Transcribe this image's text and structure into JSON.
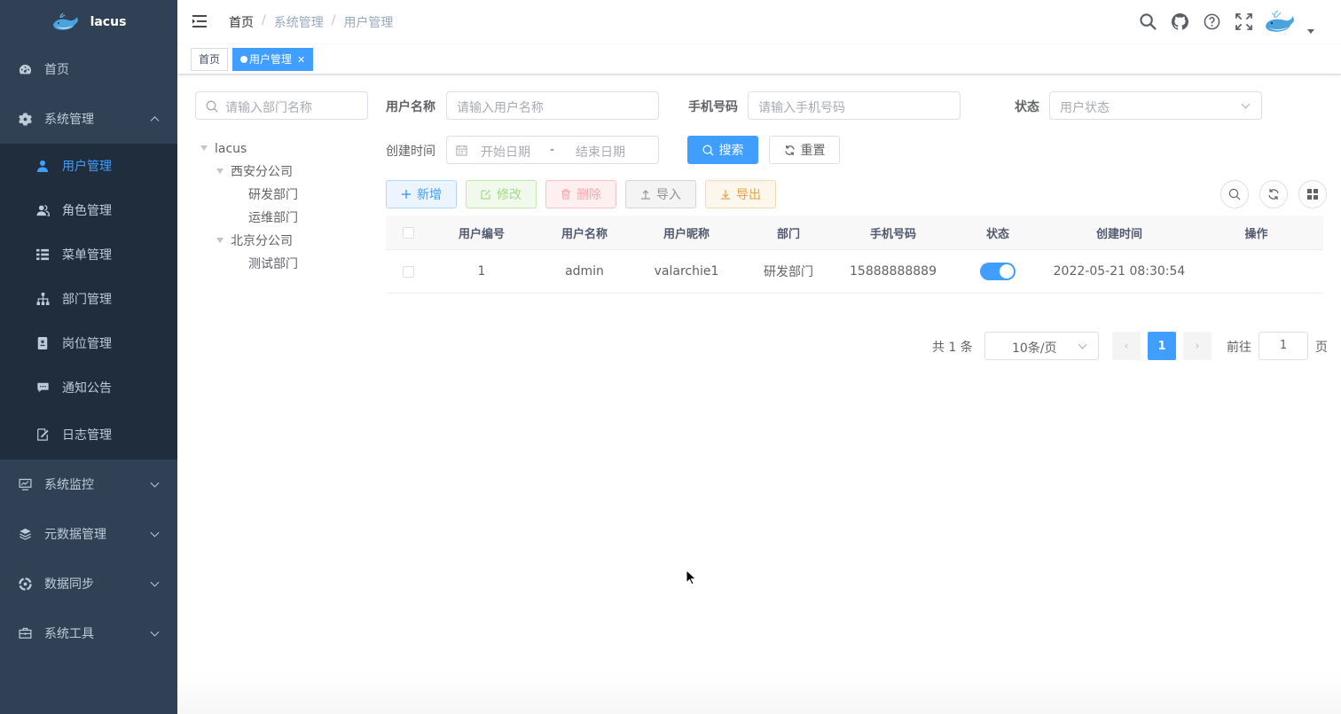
{
  "app": {
    "name": "lacus"
  },
  "sidebar": {
    "items": [
      {
        "label": "首页",
        "icon": "dashboard-icon"
      },
      {
        "label": "系统管理",
        "icon": "gear-icon",
        "expanded": true,
        "children": [
          {
            "label": "用户管理",
            "icon": "user-icon",
            "active": true
          },
          {
            "label": "角色管理",
            "icon": "peoples-icon"
          },
          {
            "label": "菜单管理",
            "icon": "tree-table-icon"
          },
          {
            "label": "部门管理",
            "icon": "org-tree-icon"
          },
          {
            "label": "岗位管理",
            "icon": "post-icon"
          },
          {
            "label": "通知公告",
            "icon": "message-icon"
          },
          {
            "label": "日志管理",
            "icon": "log-icon"
          }
        ]
      },
      {
        "label": "系统监控",
        "icon": "monitor-icon"
      },
      {
        "label": "元数据管理",
        "icon": "layers-icon"
      },
      {
        "label": "数据同步",
        "icon": "sync-icon"
      },
      {
        "label": "系统工具",
        "icon": "toolbox-icon"
      }
    ]
  },
  "breadcrumb": [
    "首页",
    "系统管理",
    "用户管理"
  ],
  "tags": [
    {
      "label": "首页",
      "active": false
    },
    {
      "label": "用户管理",
      "active": true
    }
  ],
  "dept_tree": {
    "search_placeholder": "请输入部门名称",
    "nodes": [
      {
        "label": "lacus",
        "level": 0,
        "expanded": true
      },
      {
        "label": "西安分公司",
        "level": 1,
        "expanded": true
      },
      {
        "label": "研发部门",
        "level": 2
      },
      {
        "label": "运维部门",
        "level": 2
      },
      {
        "label": "北京分公司",
        "level": 1,
        "expanded": true
      },
      {
        "label": "测试部门",
        "level": 2
      }
    ]
  },
  "search_form": {
    "username_label": "用户名称",
    "username_placeholder": "请输入用户名称",
    "phone_label": "手机号码",
    "phone_placeholder": "请输入手机号码",
    "status_label": "状态",
    "status_placeholder": "用户状态",
    "created_label": "创建时间",
    "start_placeholder": "开始日期",
    "range_sep": "-",
    "end_placeholder": "结束日期",
    "search_button": "搜索",
    "reset_button": "重置"
  },
  "toolbar": {
    "add": "新增",
    "edit": "修改",
    "delete": "删除",
    "import": "导入",
    "export": "导出"
  },
  "table": {
    "columns": [
      "用户编号",
      "用户名称",
      "用户昵称",
      "部门",
      "手机号码",
      "状态",
      "创建时间",
      "操作"
    ],
    "rows": [
      {
        "id": "1",
        "username": "admin",
        "nickname": "valarchie1",
        "dept": "研发部门",
        "phone": "15888888889",
        "status_on": true,
        "created": "2022-05-21 08:30:54",
        "actions": ""
      }
    ]
  },
  "pagination": {
    "total_text": "共 1 条",
    "page_size": "10条/页",
    "current_page": "1",
    "goto_label": "前往",
    "goto_value": "1",
    "page_suffix": "页"
  },
  "colors": {
    "sidebar_bg": "#304156",
    "submenu_bg": "#1f2d3d",
    "primary": "#409eff",
    "menu_text": "#bfcbd9"
  }
}
